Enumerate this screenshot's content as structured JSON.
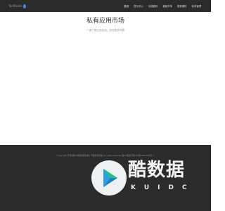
{
  "header": {
    "logo_text": "TestRedis",
    "logo_text2": "...",
    "nav": [
      "首页",
      "提示中心",
      "功能模块",
      "模板市场",
      "更新通知",
      "私有管理"
    ]
  },
  "hero": {
    "title": "私有应用市场",
    "subtitle": "一键下载立即启用，发现更多惊喜"
  },
  "footer": {
    "copyright": "Copyright 开源客服AI智能客服系统 | 开发者测试站 All rights reserved 蜀ICP备案号码 ICP备-3041234号-1"
  },
  "watermark": {
    "text": "酷数据",
    "sub": "KUIDC"
  }
}
